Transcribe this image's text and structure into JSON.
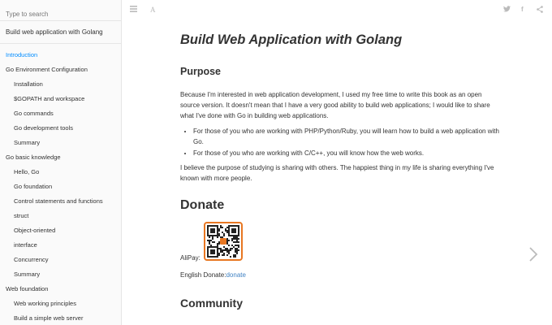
{
  "sidebar": {
    "search_placeholder": "Type to search",
    "book_link": "Build web application with Golang",
    "items": [
      {
        "label": "Introduction",
        "level": 1,
        "active": true
      },
      {
        "label": "Go Environment Configuration",
        "level": 1
      },
      {
        "label": "Installation",
        "level": 2
      },
      {
        "label": "$GOPATH and workspace",
        "level": 2
      },
      {
        "label": "Go commands",
        "level": 2
      },
      {
        "label": "Go development tools",
        "level": 2
      },
      {
        "label": "Summary",
        "level": 2
      },
      {
        "label": "Go basic knowledge",
        "level": 1
      },
      {
        "label": "Hello, Go",
        "level": 2
      },
      {
        "label": "Go foundation",
        "level": 2
      },
      {
        "label": "Control statements and functions",
        "level": 2
      },
      {
        "label": "struct",
        "level": 2
      },
      {
        "label": "Object-oriented",
        "level": 2
      },
      {
        "label": "interface",
        "level": 2
      },
      {
        "label": "Concurrency",
        "level": 2
      },
      {
        "label": "Summary",
        "level": 2
      },
      {
        "label": "Web foundation",
        "level": 1
      },
      {
        "label": "Web working principles",
        "level": 2
      },
      {
        "label": "Build a simple web server",
        "level": 2
      }
    ]
  },
  "toolbar": {
    "menu_icon": "hamburger-menu-icon",
    "font_icon": "font-settings-icon",
    "font_glyph": "A",
    "share_icons": [
      "twitter-icon",
      "facebook-icon",
      "share-icon"
    ],
    "facebook_glyph": "f"
  },
  "content": {
    "title": "Build Web Application with Golang",
    "purpose_heading": "Purpose",
    "purpose_text": "Because I'm interested in web application development, I used my free time to write this book as an open source version. It doesn't mean that I have a very good ability to build web applications; I would like to share what I've done with Go in building web applications.",
    "bullets": [
      "For those of you who are working with PHP/Python/Ruby, you will learn how to build a web application with Go.",
      "For those of you who are working with C/C++, you will know how the web works."
    ],
    "belief_text": "I believe the purpose of studying is sharing with others. The happiest thing in my life is sharing everything I've known with more people.",
    "donate_heading": "Donate",
    "alipay_label": "AliPay:",
    "english_donate_label": "English Donate:",
    "donate_link": "donate",
    "community_heading": "Community"
  },
  "navigation": {
    "next_icon": "chevron-right-icon"
  },
  "colors": {
    "accent": "#008cff",
    "link": "#4183c4",
    "qr_border": "#e87722",
    "icon_grey": "#bbbbbb"
  }
}
